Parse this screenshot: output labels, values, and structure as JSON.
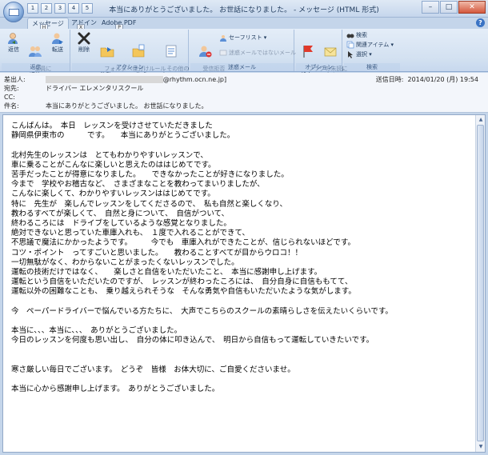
{
  "window": {
    "title": "本当にありがとうございました。 お世話になりました。 - メッセージ (HTML 形式)",
    "minimize": "–",
    "maximize": "□",
    "close": "✕"
  },
  "qat": [
    "1",
    "2",
    "3",
    "4",
    "5"
  ],
  "tabs": [
    {
      "label": "メッセージ",
      "keytip": "H"
    },
    {
      "label": "アドイン",
      "keytip": "X"
    },
    {
      "label": "Adobe PDF",
      "keytip": "P"
    }
  ],
  "ribbon": {
    "groups": {
      "reply": {
        "label": "返信",
        "buttons": [
          {
            "label": "返信"
          },
          {
            "label": "全員に\n返信"
          },
          {
            "label": "転送"
          }
        ]
      },
      "action": {
        "label": "アクション",
        "buttons": [
          {
            "label": "削除"
          },
          {
            "label": "フォルダへ\n移動▾"
          },
          {
            "label": "仕分けルール\nの作成"
          },
          {
            "label": "その他の\nアクション▾"
          }
        ]
      },
      "junk": {
        "label": "迷惑メール",
        "buttons": [
          {
            "label": "受信拒否\nリスト"
          }
        ],
        "safe_list": "セーフリスト ▾",
        "not_junk": "迷惑メールではないメール"
      },
      "options": {
        "label": "オプション",
        "buttons": [
          {
            "label": "フラグの\n設定▾"
          },
          {
            "label": "未読に\nする"
          }
        ]
      },
      "find": {
        "label": "検索",
        "items": [
          "検索",
          "関連アイテム ▾",
          "選択 ▾"
        ]
      }
    }
  },
  "header": {
    "from_label": "差出人:",
    "from_value": "@rhythm.ocn.ne.jp]",
    "to_label": "宛先:",
    "to_value": "ドライバー エレメンタリスクール",
    "cc_label": "CC:",
    "cc_value": "",
    "subject_label": "件名:",
    "subject_value": "本当にありがとうございました。 お世話になりました。",
    "sent_label": "送信日時:",
    "sent_value": "2014/01/20 (月) 19:54"
  },
  "body": {
    "lines": [
      "こんばんは。　本日　レッスンを受けさせていただきました",
      "静岡県伊東市の　　　です。　　本当にありがとうございました。",
      "",
      "北村先生のレッスンは　とてもわかりやすいレッスンで、",
      "車に乗ることがこんなに楽しいと思えたのははじめてです。",
      "苦手だったことが得意になりました。　　できなかったことが好きになりました。",
      "今まで　学校やお稽古など、　さまざまなことを教わってまいりましたが、",
      "こんなに楽しくて、わかりやすいレッスンははじめてです。",
      "特に　先生が　楽しんでレッスンをしてくださるので、　私も自然と楽しくなり、",
      "教わるすべてが楽しくて、　自然と身について、　自信がついて、",
      "終わるころには　ドライブをしているような感覚となりました。",
      "絶対できないと思っていた車庫入れも、　１度で入れることができて、",
      "不思議で魔法にかかったようです。　　　今でも　車庫入れができたことが、信じられないほどです。",
      "コツ・ポイント　ってすごいと思いました。　　教わることすべてが目からウロコ！！",
      "一切無駄がなく、わからないことがまったくないレッスンでした。",
      "運転の技術だけではなく、　　楽しさと自信をいただいたこと、　本当に感謝申し上げます。",
      "運転という自信をいただいたのですが、　レッスンが終わったころには、　自分自身に自信ももてて、",
      "運転以外の困難なことも、　乗り越えられそうな　そんな勇気や自信もいただいたような気がします。",
      "",
      "今　ペーパードライバーで悩んでいる方たちに、　大声でこちらのスクールの素晴らしさを伝えたいくらいです。",
      "",
      "本当に、、、本当に、、、　ありがとうございました。",
      "今日のレッスンを何度も思い出し、　自分の体に叩き込んで、　明日から自信もって運転していきたいです。",
      "",
      "",
      "寒さ厳しい毎日でございます。　どうぞ　皆様　お体大切に、ご自愛くださいませ。",
      "",
      "本当に心から感謝申し上げます。　ありがとうございました。"
    ]
  }
}
